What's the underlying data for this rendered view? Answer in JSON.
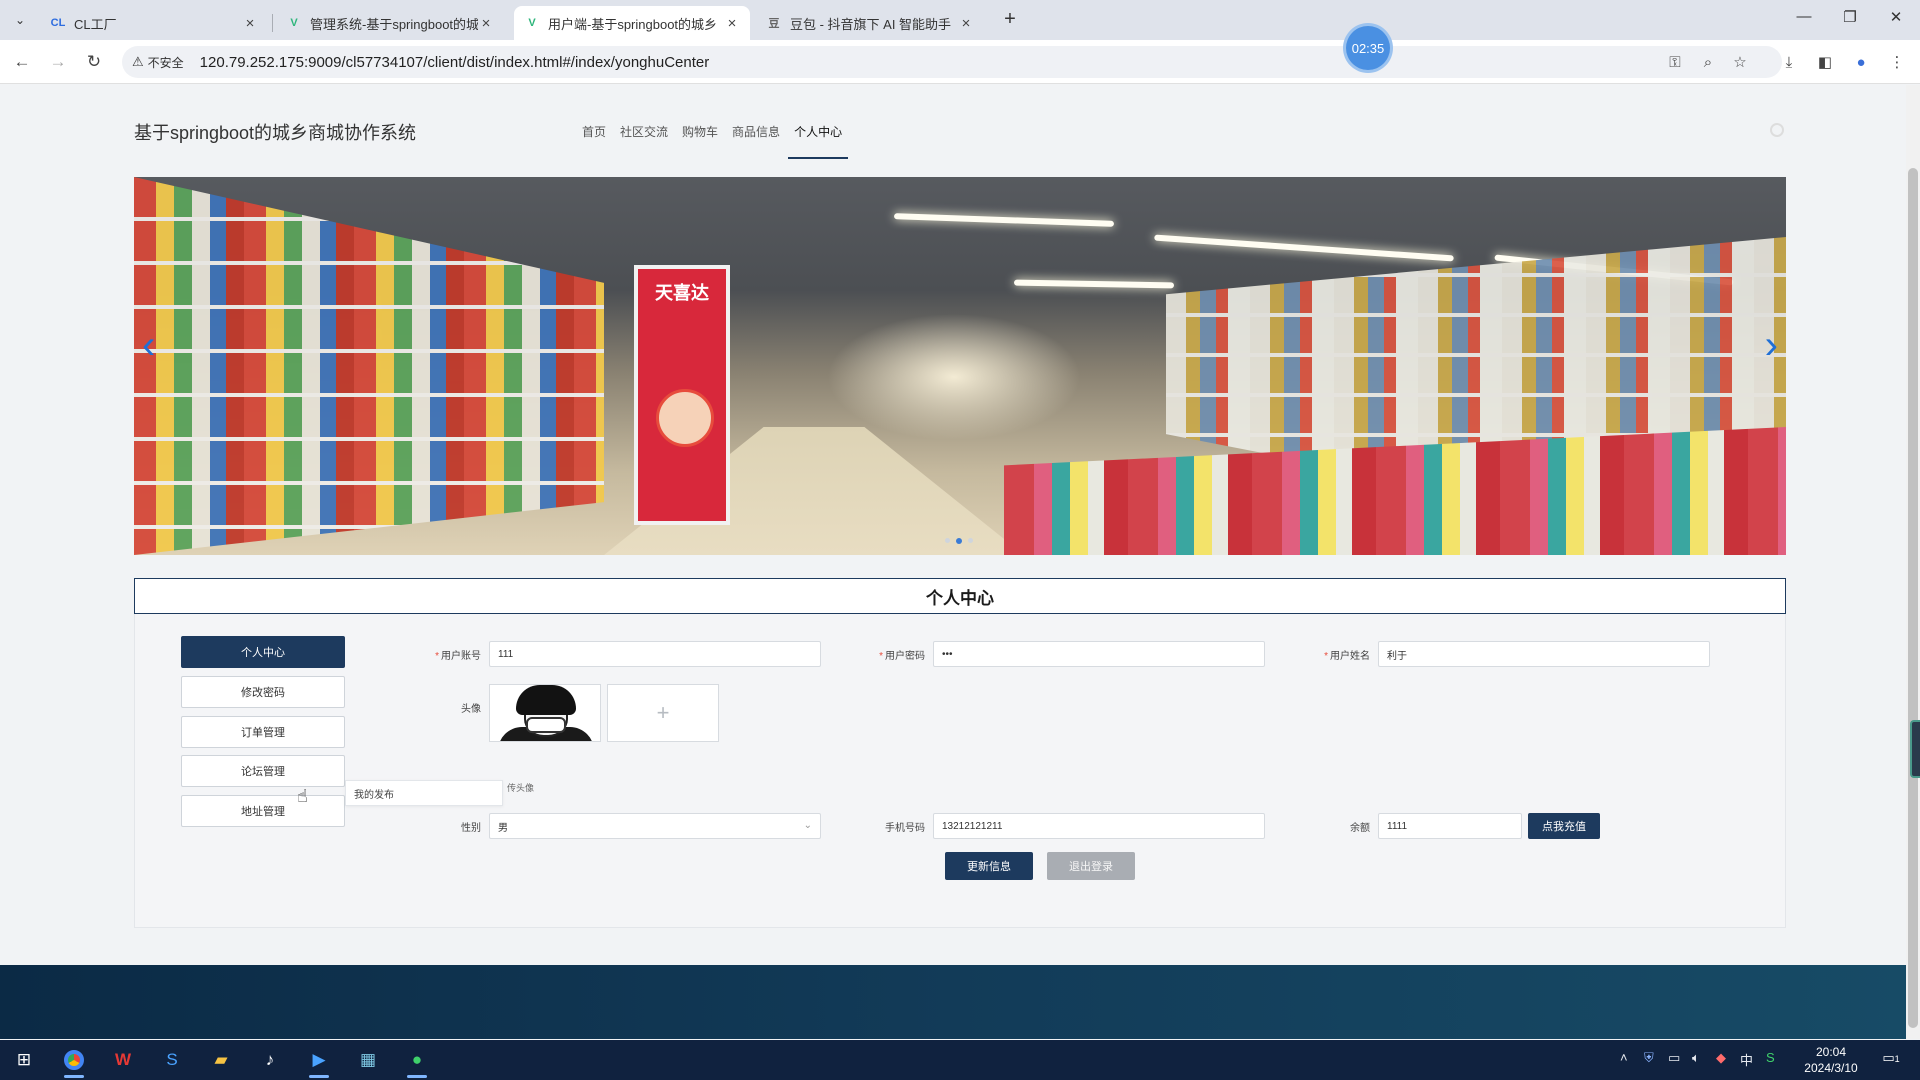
{
  "browser": {
    "tabs": [
      {
        "title": "CL工厂",
        "favicon": "CL",
        "active": false
      },
      {
        "title": "管理系统-基于springboot的城",
        "favicon": "V",
        "active": false
      },
      {
        "title": "用户端-基于springboot的城乡",
        "favicon": "V",
        "active": true
      },
      {
        "title": "豆包 - 抖音旗下 AI 智能助手",
        "favicon": "豆",
        "active": false
      }
    ],
    "security_label": "不安全",
    "url": "120.79.252.175:9009/cl57734107/client/dist/index.html#/index/yonghuCenter",
    "timer": "02:35"
  },
  "site": {
    "title": "基于springboot的城乡商城协作系统",
    "nav": [
      {
        "label": "首页",
        "active": false
      },
      {
        "label": "社区交流",
        "active": false
      },
      {
        "label": "购物车",
        "active": false
      },
      {
        "label": "商品信息",
        "active": false
      },
      {
        "label": "个人中心",
        "active": true
      }
    ]
  },
  "carousel": {
    "slide_count": 3,
    "active_slide": 2,
    "promo_sign": "天喜达"
  },
  "center": {
    "title": "个人中心",
    "sidebar": [
      {
        "label": "个人中心",
        "active": true
      },
      {
        "label": "修改密码",
        "active": false
      },
      {
        "label": "订单管理",
        "active": false
      },
      {
        "label": "论坛管理",
        "active": false
      },
      {
        "label": "地址管理",
        "active": false
      }
    ],
    "forum_submenu": [
      "我的发布"
    ],
    "form": {
      "account_label": "用户账号",
      "account_value": "111",
      "password_label": "用户密码",
      "password_value": "•••",
      "name_label": "用户姓名",
      "name_value": "利于",
      "avatar_label": "头像",
      "upload_plus": "+",
      "upload_tip": "传头像",
      "gender_label": "性别",
      "gender_value": "男",
      "phone_label": "手机号码",
      "phone_value": "13212121211",
      "balance_label": "余额",
      "balance_value": "1111",
      "recharge_button": "点我充值",
      "update_button": "更新信息",
      "logout_button": "退出登录"
    }
  },
  "taskbar": {
    "time": "20:04",
    "date": "2024/3/10",
    "ime": "中",
    "notifications": "1"
  }
}
